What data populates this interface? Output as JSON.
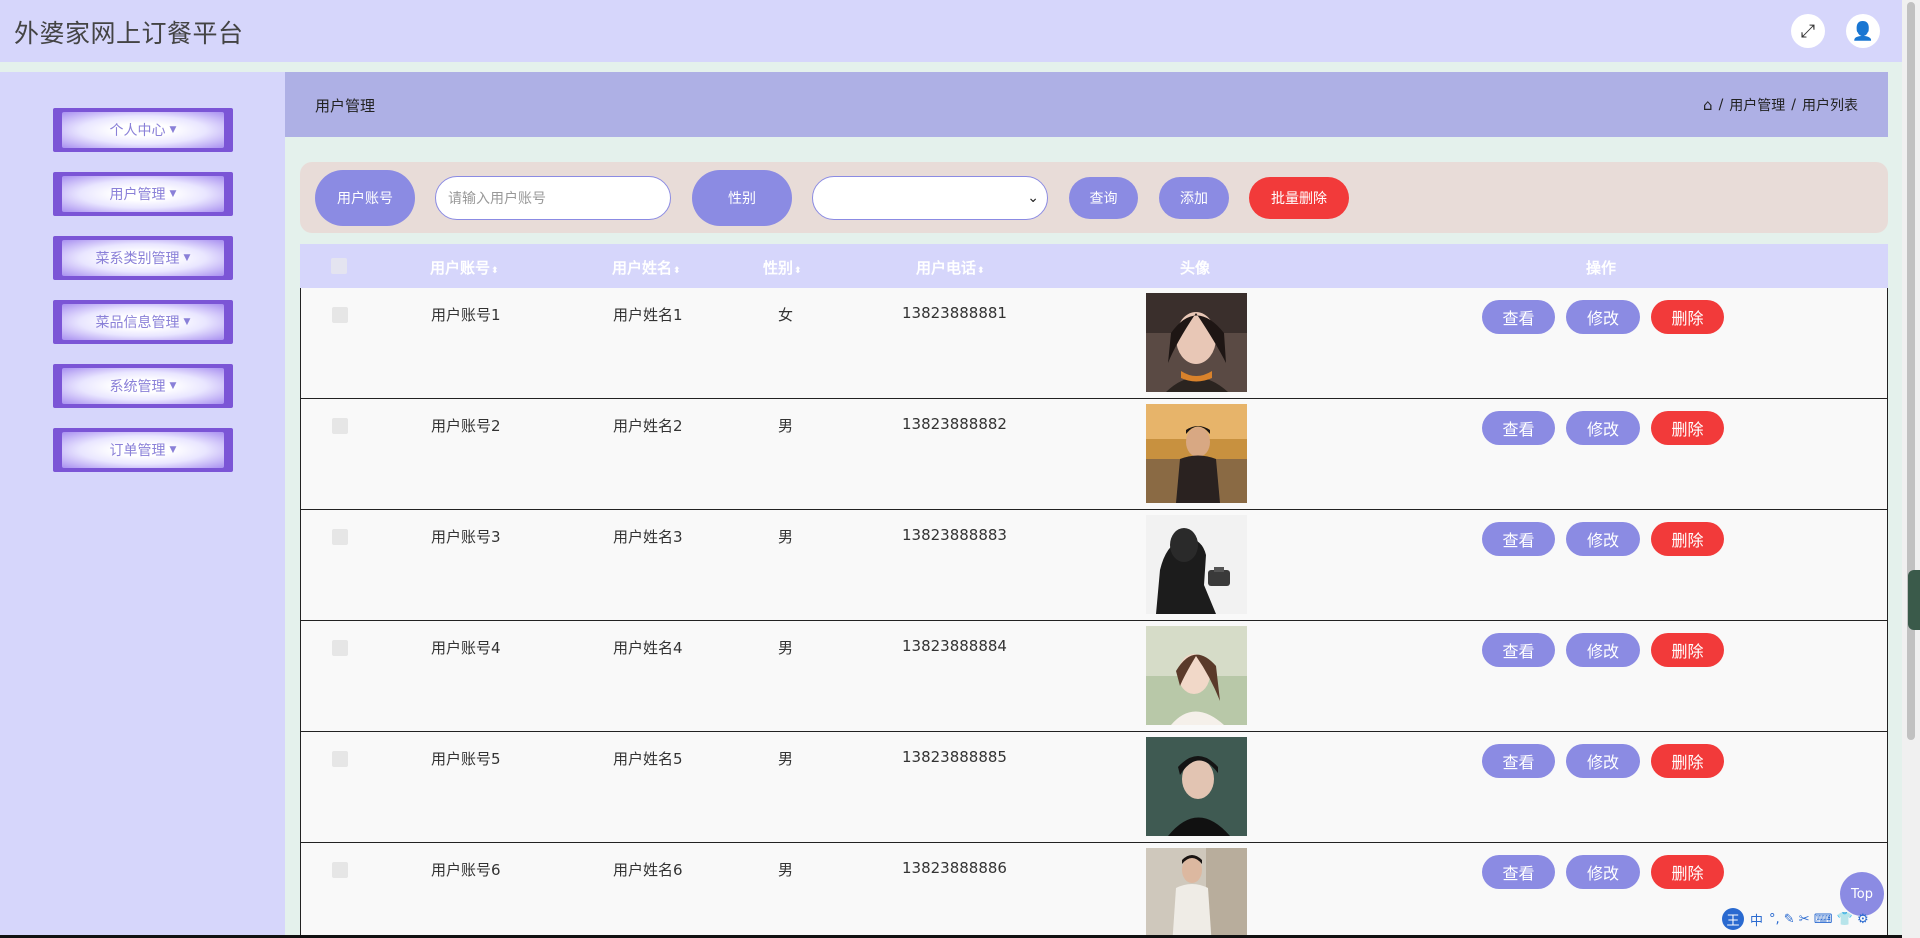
{
  "header": {
    "app_title": "外婆家网上订餐平台",
    "fullscreen_icon": "⤢",
    "user_icon": "👤"
  },
  "sidebar": {
    "items": [
      {
        "label": "个人中心"
      },
      {
        "label": "用户管理"
      },
      {
        "label": "菜系类别管理"
      },
      {
        "label": "菜品信息管理"
      },
      {
        "label": "系统管理"
      },
      {
        "label": "订单管理"
      }
    ]
  },
  "breadcrumb": {
    "page_title": "用户管理",
    "home_icon": "⌂",
    "sep": "/",
    "path": [
      "用户管理",
      "用户列表"
    ]
  },
  "filter": {
    "account_label": "用户账号",
    "account_placeholder": "请输入用户账号",
    "gender_label": "性别",
    "select_value": "",
    "search_label": "查询",
    "add_label": "添加",
    "batch_delete_label": "批量删除"
  },
  "table": {
    "headers": {
      "account": "用户账号",
      "name": "用户姓名",
      "gender": "性别",
      "phone": "用户电话",
      "avatar": "头像",
      "actions": "操作"
    },
    "sort_icon": "⬍",
    "rows": [
      {
        "account": "用户账号1",
        "name": "用户姓名1",
        "gender": "女",
        "phone": "13823888881"
      },
      {
        "account": "用户账号2",
        "name": "用户姓名2",
        "gender": "男",
        "phone": "13823888882"
      },
      {
        "account": "用户账号3",
        "name": "用户姓名3",
        "gender": "男",
        "phone": "13823888883"
      },
      {
        "account": "用户账号4",
        "name": "用户姓名4",
        "gender": "男",
        "phone": "13823888884"
      },
      {
        "account": "用户账号5",
        "name": "用户姓名5",
        "gender": "男",
        "phone": "13823888885"
      },
      {
        "account": "用户账号6",
        "name": "用户姓名6",
        "gender": "男",
        "phone": "13823888886"
      }
    ],
    "view_label": "查看",
    "edit_label": "修改",
    "delete_label": "删除"
  },
  "top_button": "Top",
  "ime": {
    "logo": "王",
    "mode": "中",
    "icons": "°, ✎ ✂ ⌨ 👕 ⚙"
  },
  "colors": {
    "accent": "#8b8be3",
    "danger": "#f23a3a",
    "sidebar_bg": "#d6d6fb",
    "breadcrumb_bg": "#aeb0e5",
    "menu_border": "#7b55d6"
  }
}
